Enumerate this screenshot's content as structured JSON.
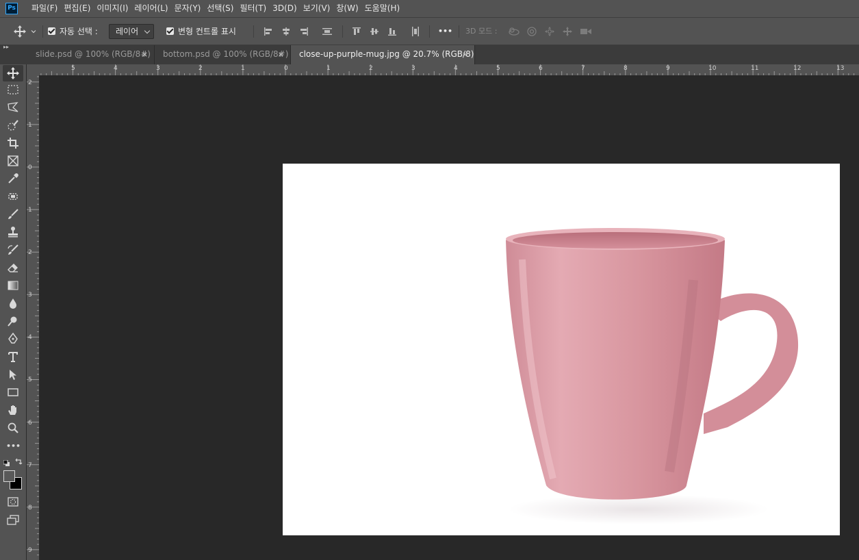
{
  "app": {
    "logo_text": "Ps"
  },
  "menu": [
    {
      "label": "파일(F)"
    },
    {
      "label": "편집(E)"
    },
    {
      "label": "이미지(I)"
    },
    {
      "label": "레이어(L)"
    },
    {
      "label": "문자(Y)"
    },
    {
      "label": "선택(S)"
    },
    {
      "label": "필터(T)"
    },
    {
      "label": "3D(D)"
    },
    {
      "label": "보기(V)"
    },
    {
      "label": "창(W)"
    },
    {
      "label": "도움말(H)"
    }
  ],
  "options": {
    "auto_select_label": "자동 선택 :",
    "auto_select_checked": true,
    "auto_select_target": "레이어",
    "show_transform_label": "변형 컨트롤 표시",
    "show_transform_checked": true,
    "more_label": "•••",
    "mode_3d_label": "3D 모드 :"
  },
  "tabs": [
    {
      "title": "slide.psd @ 100% (RGB/8#)",
      "close": "×",
      "active": false
    },
    {
      "title": "bottom.psd @ 100% (RGB/8#)",
      "close": "×",
      "active": false
    },
    {
      "title": "close-up-purple-mug.jpg @ 20.7% (RGB/8)",
      "close": "×",
      "active": true
    }
  ],
  "rulers": {
    "top": [
      "5",
      "4",
      "3",
      "2",
      "1",
      "0",
      "1",
      "2",
      "3",
      "4",
      "5",
      "6",
      "7",
      "8",
      "9",
      "10",
      "11",
      "12",
      "13"
    ],
    "left": [
      "2",
      "1",
      "0",
      "1",
      "2",
      "3",
      "4",
      "5",
      "6",
      "7",
      "8",
      "9"
    ]
  },
  "tools": {
    "more_label": "•••"
  },
  "colors": {
    "foreground": "#595959",
    "background": "#000000",
    "mug_body": "#d89ca6",
    "mug_shadow": "#b7727e",
    "canvas_bg": "#282828",
    "panel_bg": "#535353"
  }
}
